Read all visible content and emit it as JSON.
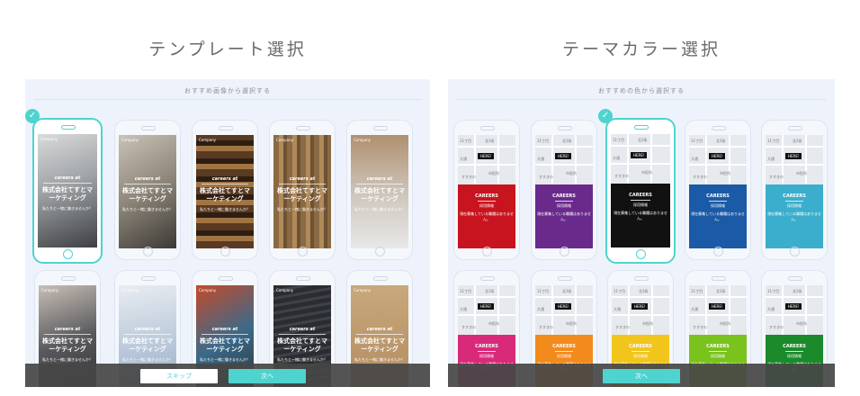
{
  "template_section": {
    "heading": "テンプレート選択",
    "subtitle": "おすすめ画像から選択する",
    "logo": "Company",
    "tagline": "careers at",
    "company_name": "株式会社てすとマーケティング",
    "small_text": "私たちと一緒に働きませんか？",
    "skip_label": "スキップ",
    "next_label": "次へ",
    "selected_index": 0
  },
  "color_section": {
    "heading": "テーマカラー選択",
    "subtitle": "おすすめの色から選択する",
    "map_labels": [
      "11丁目",
      "北3条",
      "大通",
      "市役所",
      "すすきの"
    ],
    "marker_label": "HERE!",
    "careers_title": "CAREERS",
    "careers_sub": "採用情報",
    "careers_desc": "現在募集している職種はありません。",
    "next_label": "次へ",
    "selected_index": 2,
    "colors_row1": [
      "#c8141e",
      "#6a2a8c",
      "#111111",
      "#1a5aa6",
      "#3aaecc"
    ],
    "colors_row2": [
      "#d92a7a",
      "#f28a1c",
      "#f2c51c",
      "#7ac21c",
      "#1a8a2a"
    ]
  },
  "accent_color": "#4fd3cf"
}
